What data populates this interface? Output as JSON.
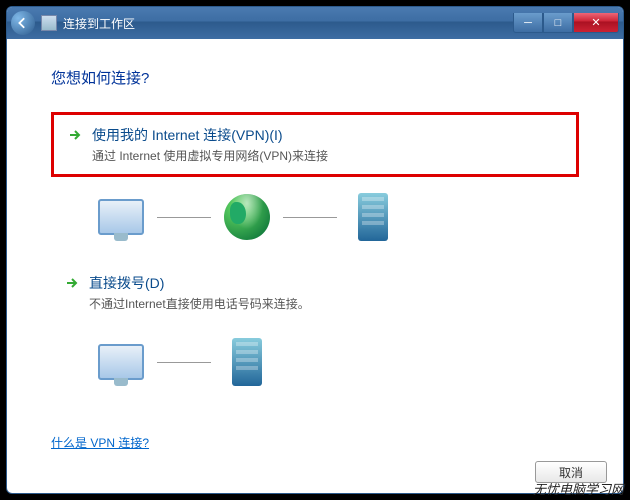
{
  "window": {
    "title": "连接到工作区"
  },
  "heading": "您想如何连接?",
  "option1": {
    "title": "使用我的 Internet 连接(VPN)(I)",
    "desc": "通过 Internet 使用虚拟专用网络(VPN)来连接"
  },
  "option2": {
    "title": "直接拨号(D)",
    "desc": "不通过Internet直接使用电话号码来连接。"
  },
  "link": "什么是 VPN 连接?",
  "cancel": "取消",
  "watermark": "无忧电脑学习网"
}
